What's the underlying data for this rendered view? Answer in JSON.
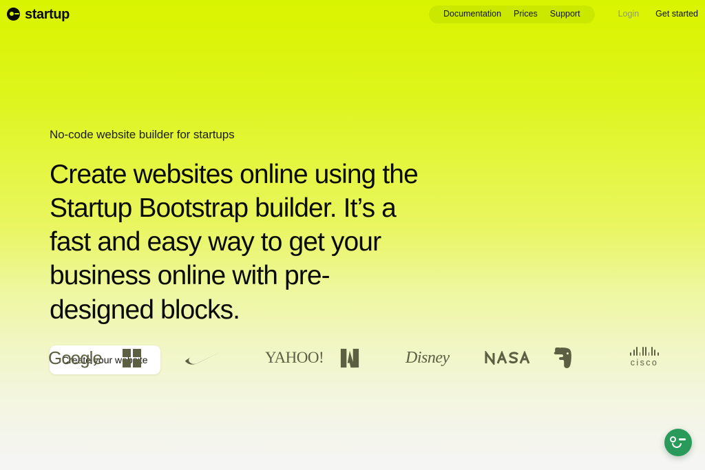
{
  "brand": {
    "name": "startup",
    "logo_icon": "face-dot-dash-icon"
  },
  "nav": {
    "pill_links": [
      {
        "label": "Documentation"
      },
      {
        "label": "Prices"
      },
      {
        "label": "Support"
      }
    ],
    "login_label": "Login",
    "get_started_label": "Get started"
  },
  "hero": {
    "eyebrow": "No-code website builder for startups",
    "headline": "Create websites online using the Startup Bootstrap builder. It’s a fast and easy way to get your business online with pre-designed blocks.",
    "cta_label": "Create your website"
  },
  "logos": [
    {
      "name": "google",
      "label": "Google"
    },
    {
      "name": "microsoft",
      "label": "Microsoft"
    },
    {
      "name": "nike",
      "label": "Nike"
    },
    {
      "name": "yahoo",
      "label": "YAHOO",
      "suffix": "!"
    },
    {
      "name": "adobe",
      "label": "Adobe"
    },
    {
      "name": "disney",
      "label": "Disney"
    },
    {
      "name": "nasa",
      "label": "NASA"
    },
    {
      "name": "evernote",
      "label": "Evernote"
    },
    {
      "name": "cisco",
      "label": "cisco"
    }
  ],
  "chat": {
    "icon": "chat-face-icon",
    "color": "#2a9a5b"
  },
  "colors": {
    "hero_top": "#d9f400",
    "hero_bottom": "#f5f5f0",
    "nav_pill": "#cbe800",
    "text": "#0b0b06",
    "muted": "#8f9a60",
    "logo_gray": "#5c5f42",
    "cta_bg": "#ffffff"
  }
}
